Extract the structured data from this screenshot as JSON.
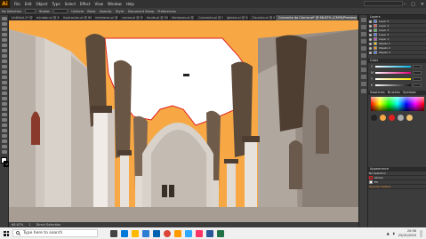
{
  "app": {
    "logo": "Ai"
  },
  "menu": [
    "File",
    "Edit",
    "Object",
    "Type",
    "Select",
    "Effect",
    "View",
    "Window",
    "Help"
  ],
  "toolbar_top": {
    "no_selection": "No Selection",
    "stroke_label": "Stroke:",
    "uniform": "Uniform",
    "basic": "Basic",
    "opacity_label": "Opacity:",
    "style_label": "Style:",
    "document_setup": "Document Setup",
    "preferences": "Preferences"
  },
  "tabs": [
    "Untitled-1* @ 100% (RGB/Preview)",
    "mirador.ai @ 50%",
    "ilustracion.ai @ 66%",
    "interiores.ai @ 50%",
    "carmo.ai @ 50%",
    "fondo.ai @ 50%",
    "Ventanas.ai @ 50%",
    "Convento.ai @ 150%",
    "Iglesia.ai @ 50%",
    "Claustro.ai @ 66%",
    "Convento do Carmo.ai* @ 66.67% (CMYK/Preview)"
  ],
  "status": {
    "zoom": "66.67%",
    "page": "1",
    "tool": "Direct Selection"
  },
  "layers_panel": {
    "title": "Layers",
    "layers": [
      {
        "name": "Layer 5",
        "color": "#4a7bff"
      },
      {
        "name": "Layer 4",
        "color": "#ff5050"
      },
      {
        "name": "Layer 3",
        "color": "#50c850"
      },
      {
        "name": "Layer 2",
        "color": "#4a7bff"
      },
      {
        "name": "Layer 1",
        "color": "#c850c8"
      },
      {
        "name": "Objeto 1",
        "color": "#ffcc00"
      },
      {
        "name": "Objeto 2",
        "color": "#ff9900"
      },
      {
        "name": "Objeto 3",
        "color": "#4a7bff"
      }
    ]
  },
  "color_panel": {
    "title": "Color",
    "sliders": [
      {
        "label": "C",
        "value": "0",
        "color": "#00b4e6"
      },
      {
        "label": "M",
        "value": "35",
        "color": "#e6007e"
      },
      {
        "label": "Y",
        "value": "70",
        "color": "#ffe600"
      },
      {
        "label": "K",
        "value": "0",
        "color": "#111111"
      }
    ]
  },
  "swatches_panel": {
    "tabs": [
      "Swatches",
      "Brushes",
      "Symbols"
    ]
  },
  "bottom_panel": {
    "title": "Appearance",
    "item": "No Selection",
    "stroke": "Stroke",
    "fill": "Fill",
    "opacity": "Opacity: Default"
  },
  "taskbar": {
    "search_placeholder": "Type here to search",
    "apps": [
      {
        "name": "task-view",
        "color": "#444444"
      },
      {
        "name": "edge",
        "color": "#0078d7"
      },
      {
        "name": "explorer",
        "color": "#ffb900"
      },
      {
        "name": "store",
        "color": "#2d7dd2"
      },
      {
        "name": "mail",
        "color": "#0063b1"
      },
      {
        "name": "chrome",
        "color": "#db4437"
      },
      {
        "name": "illustrator",
        "color": "#ff9a00"
      },
      {
        "name": "photoshop",
        "color": "#31a8ff"
      },
      {
        "name": "indesign",
        "color": "#ff3366"
      },
      {
        "name": "word",
        "color": "#2b579a"
      },
      {
        "name": "excel",
        "color": "#217346"
      }
    ],
    "time": "20:56",
    "date": "25/01/2020"
  },
  "colors": {
    "sky": "#ffffff",
    "orange": "#f7a844",
    "arch_dark": "#5c4a3a",
    "wall": "#cfc7bf",
    "wall_shadow": "#9a8f86",
    "accent_red": "#e02020"
  }
}
